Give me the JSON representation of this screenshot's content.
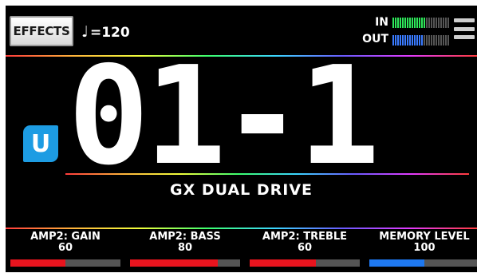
{
  "header": {
    "effects_label": "EFFECTS",
    "tempo": "=120",
    "note_icon": "♩",
    "in_label": "IN",
    "out_label": "OUT",
    "in_meter_level": 0.6,
    "out_meter_level": 0.55,
    "in_color": "#2ee85a",
    "out_color": "#3a7bff"
  },
  "patch": {
    "bank_badge": "U",
    "number": "01-1",
    "name": "GX DUAL DRIVE",
    "badge_color": "#1d9ce3"
  },
  "params": [
    {
      "name": "AMP2: GAIN",
      "value": "60",
      "level": 0.5,
      "color": "#e8141e"
    },
    {
      "name": "AMP2: BASS",
      "value": "80",
      "level": 0.8,
      "color": "#e8141e"
    },
    {
      "name": "AMP2: TREBLE",
      "value": "60",
      "level": 0.6,
      "color": "#e8141e"
    },
    {
      "name": "MEMORY LEVEL",
      "value": "100",
      "level": 0.5,
      "color": "#1e78f0"
    }
  ]
}
